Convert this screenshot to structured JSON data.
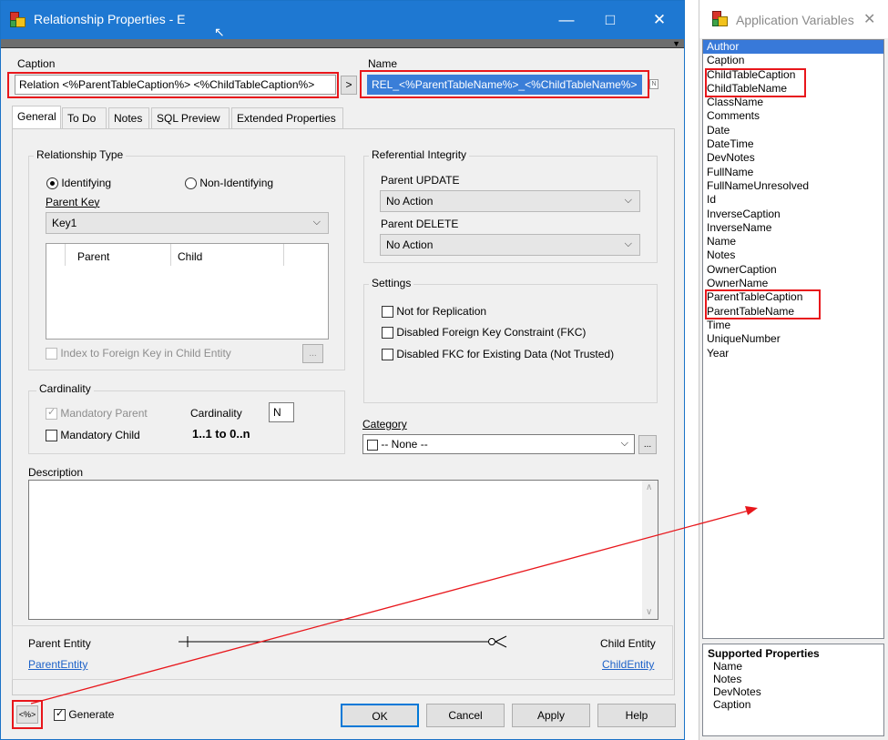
{
  "dialog": {
    "title": "Relationship Properties - E",
    "caption_label": "Caption",
    "caption_value": "Relation <%ParentTableCaption%> <%ChildTableCaption%>",
    "arrow_button": ">",
    "name_label": "Name",
    "name_value": "REL_<%ParentTableName%>_<%ChildTableName%>",
    "tabs": [
      "General",
      "To Do",
      "Notes",
      "SQL Preview",
      "Extended Properties"
    ],
    "relationship_type": {
      "title": "Relationship Type",
      "identifying": "Identifying",
      "non_identifying": "Non-Identifying",
      "parent_key_label": "Parent Key",
      "parent_key_value": "Key1",
      "grid_headers": [
        "Parent",
        "Child"
      ],
      "index_checkbox": "Index to Foreign Key in Child Entity",
      "ellipsis": "..."
    },
    "referential_integrity": {
      "title": "Referential Integrity",
      "update_label": "Parent UPDATE",
      "update_value": "No Action",
      "delete_label": "Parent DELETE",
      "delete_value": "No Action"
    },
    "settings": {
      "title": "Settings",
      "items": [
        "Not for Replication",
        "Disabled Foreign Key Constraint (FKC)",
        "Disabled FKC for Existing Data (Not Trusted)"
      ]
    },
    "cardinality": {
      "title": "Cardinality",
      "mandatory_parent": "Mandatory Parent",
      "mandatory_child": "Mandatory Child",
      "cardinality_label": "Cardinality",
      "cardinality_value": "N",
      "summary": "1..1 to 0..n"
    },
    "category": {
      "label": "Category",
      "value": "-- None --",
      "ellipsis": "..."
    },
    "description_label": "Description",
    "entities": {
      "parent_label": "Parent Entity",
      "parent_link": "ParentEntity",
      "child_label": "Child Entity",
      "child_link": "ChildEntity"
    },
    "footer": {
      "macro_button": "<%>",
      "generate": "Generate",
      "ok": "OK",
      "cancel": "Cancel",
      "apply": "Apply",
      "help": "Help"
    }
  },
  "app_variables": {
    "title": "Application Variables",
    "items": [
      "Author",
      "Caption",
      "ChildTableCaption",
      "ChildTableName",
      "ClassName",
      "Comments",
      "Date",
      "DateTime",
      "DevNotes",
      "FullName",
      "FullNameUnresolved",
      "Id",
      "InverseCaption",
      "InverseName",
      "Name",
      "Notes",
      "OwnerCaption",
      "OwnerName",
      "ParentTableCaption",
      "ParentTableName",
      "Time",
      "UniqueNumber",
      "Year"
    ],
    "supported_title": "Supported Properties",
    "supported": [
      "Name",
      "Notes",
      "DevNotes",
      "Caption"
    ]
  },
  "colors": {
    "titlebar": "#1e78d2",
    "highlight": "#e8161b",
    "selection": "#3879d9",
    "link": "#1e62c8"
  }
}
